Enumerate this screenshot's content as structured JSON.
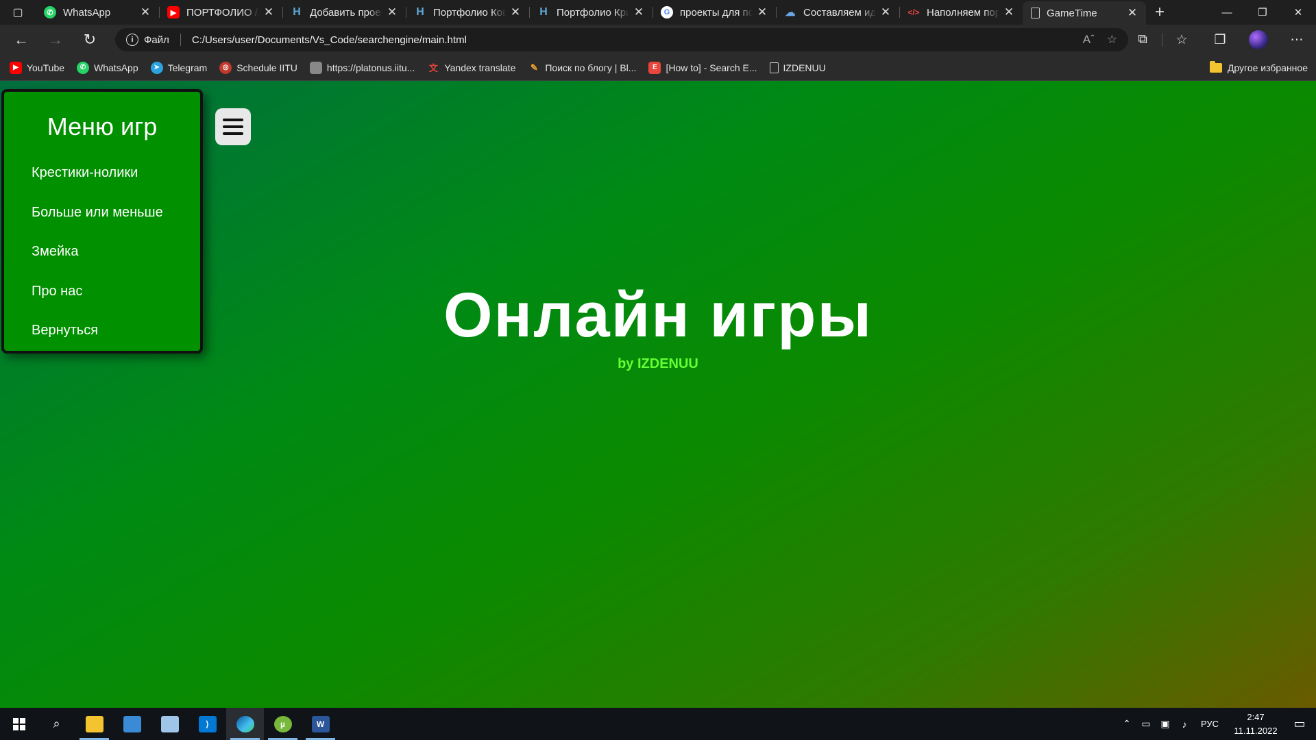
{
  "browser": {
    "tabs": [
      {
        "title": "WhatsApp",
        "favicon": "whatsapp-icon",
        "color": "#25d366"
      },
      {
        "title": "ПОРТФОЛИО //",
        "favicon": "youtube-icon",
        "color": "#ff0000"
      },
      {
        "title": "Добавить проект",
        "favicon": "habr-icon",
        "color": "#5da9d6"
      },
      {
        "title": "Портфолио Ковалёва",
        "favicon": "habr-icon",
        "color": "#5da9d6"
      },
      {
        "title": "Портфолио Кривенко",
        "favicon": "habr-icon",
        "color": "#5da9d6"
      },
      {
        "title": "проекты для портфолио",
        "favicon": "google-icon",
        "color": "#ffffff"
      },
      {
        "title": "Составляем идеальное",
        "favicon": "gear-cloud-icon",
        "color": "#6aa7e8"
      },
      {
        "title": "Наполняем портфолио",
        "favicon": "code-icon",
        "color": "#e8453c"
      },
      {
        "title": "GameTime",
        "favicon": "page-icon",
        "color": "#cccccc",
        "active": true
      }
    ],
    "address": {
      "scheme_label": "Файл",
      "url": "C:/Users/user/Documents/Vs_Code/searchengine/main.html"
    },
    "bookmarks": [
      {
        "label": "YouTube",
        "icon": "youtube-icon",
        "color": "#ff0000"
      },
      {
        "label": "WhatsApp",
        "icon": "whatsapp-icon",
        "color": "#25d366"
      },
      {
        "label": "Telegram",
        "icon": "telegram-icon",
        "color": "#2aa3e0"
      },
      {
        "label": "Schedule IITU",
        "icon": "schedule-icon",
        "color": "#c0392b"
      },
      {
        "label": "https://platonus.iitu...",
        "icon": "page-icon",
        "color": "#888888"
      },
      {
        "label": "Yandex translate",
        "icon": "translate-icon",
        "color": "#e8453c"
      },
      {
        "label": "Поиск по блогу | Bl...",
        "icon": "blog-icon",
        "color": "#f0a030"
      },
      {
        "label": "[How to] - Search E...",
        "icon": "search-engine-icon",
        "color": "#e8453c"
      },
      {
        "label": "IZDENUU",
        "icon": "page-icon",
        "color": "#cccccc"
      }
    ],
    "other_bookmarks": "Другое избранное"
  },
  "page": {
    "menu": {
      "title": "Меню игр",
      "items": [
        "Крестики-нолики",
        "Больше или меньше",
        "Змейка",
        "Про нас",
        "Вернуться"
      ]
    },
    "hero": {
      "title": "Онлайн игры",
      "subtitle": "by IZDENUU"
    }
  },
  "taskbar": {
    "apps": [
      "file-explorer-icon",
      "control-panel-icon",
      "notepad-icon",
      "vscode-icon",
      "edge-icon",
      "utorrent-icon",
      "word-icon"
    ],
    "language": "РУС",
    "time": "2:47",
    "date": "11.11.2022"
  },
  "colors": {
    "menu_bg": "#009000",
    "subtitle": "#66ff33",
    "tab_bg": "#1f1f1f",
    "toolbar_bg": "#2b2b2b"
  }
}
